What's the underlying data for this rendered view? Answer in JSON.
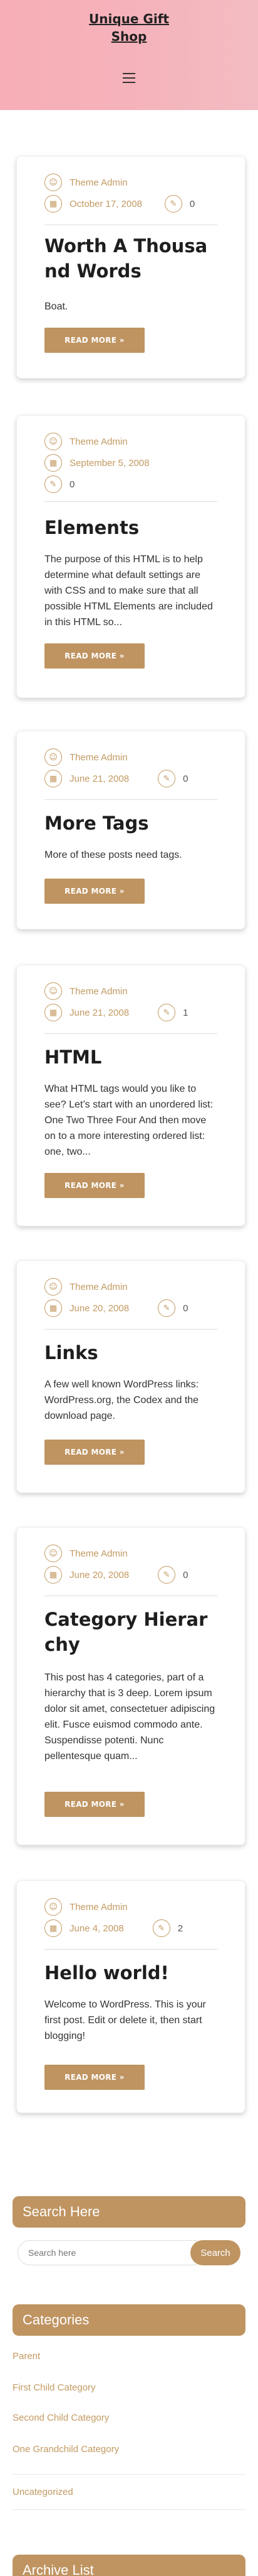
{
  "site": {
    "title": "Unique Gift Shop"
  },
  "posts": [
    {
      "author": "Theme Admin",
      "date": "October 17, 2008",
      "comments": "0",
      "title": "Worth A Thousand Words",
      "excerpt": "Boat.",
      "read_more": "READ MORE »"
    },
    {
      "author": "Theme Admin",
      "date": "September 5, 2008",
      "comments": "0",
      "title": "Elements",
      "excerpt": "The purpose of this HTML is to help determine what default settings are with CSS and to make sure that all possible HTML Elements are included in this HTML so...",
      "read_more": "READ MORE »"
    },
    {
      "author": "Theme Admin",
      "date": "June 21, 2008",
      "comments": "0",
      "title": "More Tags",
      "excerpt": "More of these posts need tags.",
      "read_more": "READ MORE »"
    },
    {
      "author": "Theme Admin",
      "date": "June 21, 2008",
      "comments": "1",
      "title": "HTML",
      "excerpt": "What HTML tags would you like to see? Let’s start with an unordered list: One Two Three Four And then move on to a more interesting ordered list: one, two...",
      "read_more": "READ MORE »"
    },
    {
      "author": "Theme Admin",
      "date": "June 20, 2008",
      "comments": "0",
      "title": "Links",
      "excerpt": "A few well known WordPress links: WordPress.org, the Codex and the download page.",
      "read_more": "READ MORE »"
    },
    {
      "author": "Theme Admin",
      "date": "June 20, 2008",
      "comments": "0",
      "title": "Category Hierarchy",
      "excerpt": "This post has 4 categories, part of a hierarchy that is 3 deep. Lorem ipsum dolor sit amet, consectetuer adipiscing elit. Fusce euismod commodo ante. Suspendisse potenti. Nunc pellentesque quam...",
      "read_more": "READ MORE »"
    },
    {
      "author": "Theme Admin",
      "date": "June 4, 2008",
      "comments": "2",
      "title": "Hello world!",
      "excerpt": "Welcome to WordPress. This is your first post. Edit or delete it, then start blogging!",
      "read_more": "READ MORE »"
    }
  ],
  "search_widget": {
    "heading": "Search Here",
    "placeholder": "Search here",
    "button": "Search"
  },
  "categories_widget": {
    "heading": "Categories",
    "items": [
      "Parent",
      "First Child Category",
      "Second Child Category",
      "One Grandchild Category",
      "Uncategorized"
    ]
  },
  "archive_widget": {
    "heading": "Archive List"
  },
  "colors": {
    "accent": "#bf9461",
    "header_bg": "#f7aeb6"
  },
  "icons": {
    "author": "user-icon",
    "date": "calendar-icon",
    "comments": "comment-icon",
    "menu": "hamburger-icon"
  }
}
